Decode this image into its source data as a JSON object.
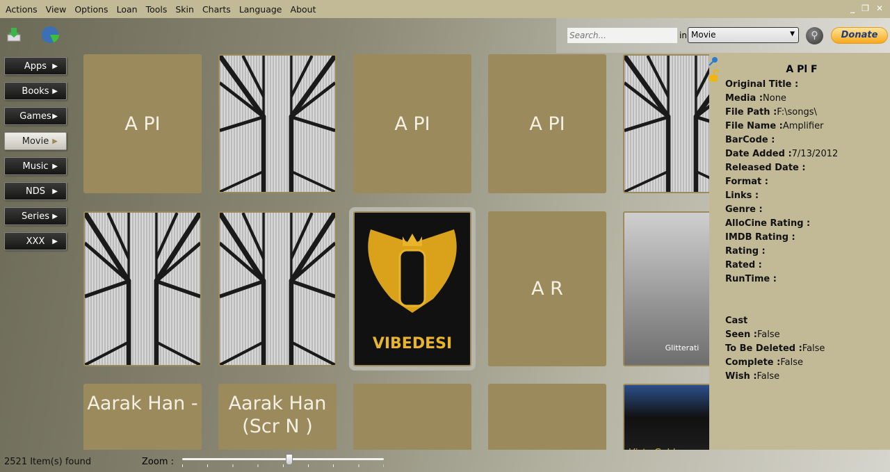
{
  "menu": [
    "Actions",
    "View",
    "Options",
    "Loan",
    "Tools",
    "Skin",
    "Charts",
    "Language",
    "About"
  ],
  "window_controls": {
    "minimize": "_",
    "restore": "❐",
    "close": "✕"
  },
  "toolbar": {
    "search_placeholder": "Search...",
    "in_label": "in",
    "media_type": "Movie",
    "donate_label": "Donate"
  },
  "categories": [
    {
      "label": "Apps",
      "active": false
    },
    {
      "label": "Books",
      "active": false
    },
    {
      "label": "Games",
      "active": false
    },
    {
      "label": "Movie",
      "active": true
    },
    {
      "label": "Music",
      "active": false
    },
    {
      "label": "NDS",
      "active": false
    },
    {
      "label": "Series",
      "active": false
    },
    {
      "label": "XXX",
      "active": false
    }
  ],
  "tiles": [
    {
      "text": "A PI",
      "kind": "text"
    },
    {
      "text": "",
      "kind": "bridge"
    },
    {
      "text": "A PI",
      "kind": "text"
    },
    {
      "text": "A PI",
      "kind": "text"
    },
    {
      "text": "",
      "kind": "bridge"
    },
    {
      "text": "",
      "kind": "bridge"
    },
    {
      "text": "",
      "kind": "bridge"
    },
    {
      "text": "VIBEDESI",
      "kind": "logo"
    },
    {
      "text": "A R",
      "kind": "text"
    },
    {
      "text": "Glitterati",
      "kind": "jewelry"
    },
    {
      "text": "Aarak Han -",
      "kind": "text"
    },
    {
      "text": "Aarak Han (Scr N )",
      "kind": "text"
    },
    {
      "text": "",
      "kind": "text"
    },
    {
      "text": "",
      "kind": "text"
    },
    {
      "text": "Vista Gold",
      "kind": "vista"
    }
  ],
  "details": {
    "title": "A Pl F",
    "fields": [
      {
        "label": "Original Title :",
        "value": ""
      },
      {
        "label": "Media :",
        "value": "None"
      },
      {
        "label": "File Path :",
        "value": "F:\\songs\\"
      },
      {
        "label": "File Name :",
        "value": "Amplifier"
      },
      {
        "label": "BarCode :",
        "value": ""
      },
      {
        "label": "Date Added :",
        "value": "7/13/2012"
      },
      {
        "label": "Released Date :",
        "value": ""
      },
      {
        "label": "Format :",
        "value": ""
      },
      {
        "label": "Links :",
        "value": ""
      },
      {
        "label": "Genre :",
        "value": ""
      },
      {
        "label": "AlloCine Rating :",
        "value": ""
      },
      {
        "label": "IMDB Rating :",
        "value": ""
      },
      {
        "label": "Rating :",
        "value": ""
      },
      {
        "label": "Rated :",
        "value": ""
      },
      {
        "label": "RunTime :",
        "value": ""
      }
    ],
    "fields2": [
      {
        "label": "Cast",
        "value": ""
      },
      {
        "label": "Seen :",
        "value": "False"
      },
      {
        "label": "To Be Deleted :",
        "value": "False"
      },
      {
        "label": "Complete :",
        "value": "False"
      },
      {
        "label": "Wish :",
        "value": "False"
      }
    ]
  },
  "status": {
    "count": "2521 Item(s) found",
    "zoom_label": "Zoom :",
    "zoom_value": 0.53
  }
}
